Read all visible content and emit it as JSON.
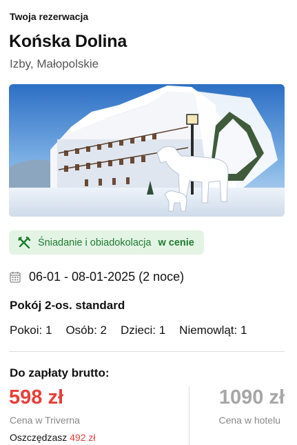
{
  "header": {
    "label": "Twoja rezerwacja"
  },
  "hotel": {
    "name": "Końska Dolina",
    "location": "Izby, Małopolskie"
  },
  "board": {
    "icon": "fork-knife-icon",
    "text": "Śniadanie i obiadokolacja",
    "emphasis": "w cenie",
    "color": "#1e7b2f",
    "background": "#e3f4e5"
  },
  "stay": {
    "icon": "calendar-icon",
    "dates": "06-01 - 08-01-2025 (2 noce)"
  },
  "room": {
    "type": "Pokój 2-os. standard",
    "occupancy": [
      {
        "label": "Pokoi: 1"
      },
      {
        "label": "Osób: 2"
      },
      {
        "label": "Dzieci: 1"
      },
      {
        "label": "Niemowląt: 1"
      }
    ]
  },
  "payment": {
    "label": "Do zapłaty brutto:",
    "triverna_price": "598 zł",
    "triverna_caption": "Cena w Triverna",
    "savings_label": "Oszczędzasz",
    "savings_amount": "492 zł",
    "hotel_price": "1090 zł",
    "hotel_caption": "Cena w hotelu",
    "accent_color": "#e8403a"
  }
}
